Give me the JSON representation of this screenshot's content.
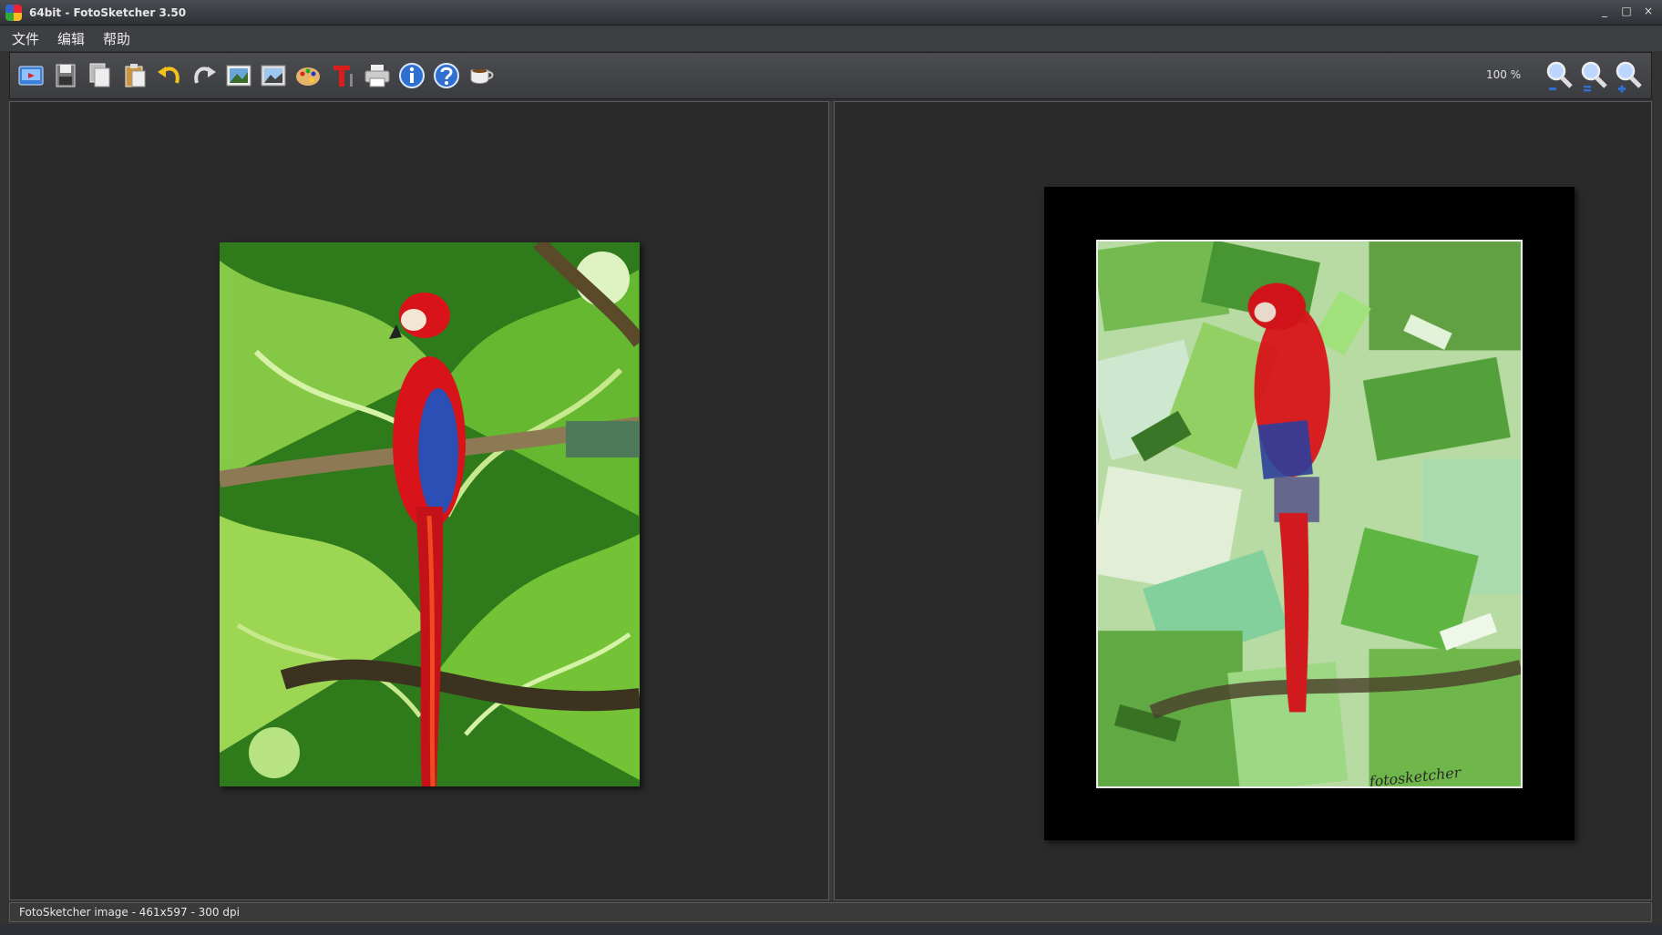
{
  "window": {
    "title": "64bit - FotoSketcher 3.50",
    "controls": [
      "_",
      "□",
      "×"
    ]
  },
  "menu": [
    "文件",
    "编辑",
    "帮助"
  ],
  "toolbar": {
    "zoom_level": "100 %"
  },
  "status": {
    "text": "FotoSketcher image - 461x597 - 300 dpi"
  },
  "sketch": {
    "signature": "fotosketcher"
  },
  "colors": {
    "background": "#2a2a2a",
    "frame": "#000000",
    "parrot_red": "#d8141a",
    "foliage_green": "#4f9a2a"
  }
}
